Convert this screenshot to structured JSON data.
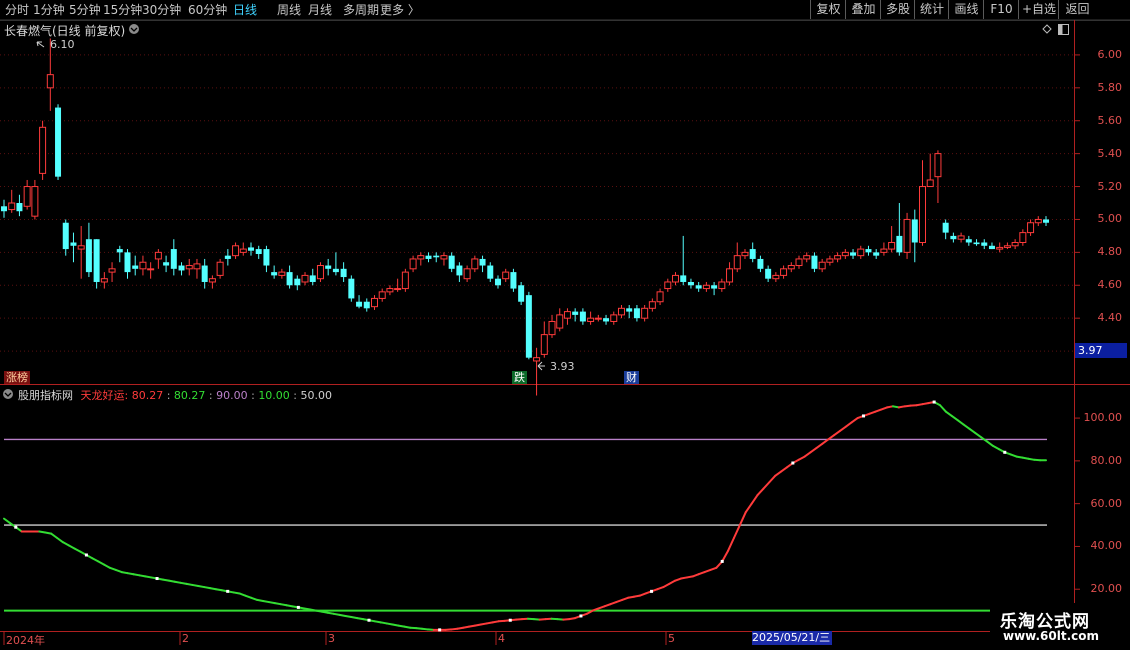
{
  "toolbar": {
    "periods": [
      {
        "label": "分时",
        "active": false
      },
      {
        "label": "1分钟",
        "active": false
      },
      {
        "label": "5分钟",
        "active": false
      },
      {
        "label": "15分钟",
        "active": false
      },
      {
        "label": "30分钟",
        "active": false
      },
      {
        "label": "60分钟",
        "active": false
      },
      {
        "label": "日线",
        "active": true
      },
      {
        "label": "周线",
        "active": false
      },
      {
        "label": "月线",
        "active": false
      },
      {
        "label": "多周期",
        "active": false
      },
      {
        "label": "更多 〉",
        "active": false
      }
    ],
    "buttons": [
      "复权",
      "叠加",
      "多股",
      "统计",
      "画线",
      "F10",
      "+自选",
      "返回"
    ]
  },
  "main_chart": {
    "title": "长春燃气(日线 前复权)",
    "high_label": "6.10",
    "low_label": "3.93",
    "last_price": "3.97",
    "tags": {
      "zhangbang": "涨榜",
      "die": "跌",
      "cai": "财"
    }
  },
  "indicator": {
    "name": "股朋指标网",
    "values": [
      {
        "text": "天龙好运: 80.27",
        "color": "#ff3b3b"
      },
      {
        "text": "80.27",
        "color": "#33dd33"
      },
      {
        "text": "90.00",
        "color": "#b980c8"
      },
      {
        "text": "10.00",
        "color": "#33dd33"
      },
      {
        "text": "50.00",
        "color": "#d0d0d0"
      }
    ]
  },
  "time_axis": {
    "labels": [
      "2024年",
      "2",
      "3",
      "4",
      "5"
    ],
    "selected_date": "2025/05/21/三"
  },
  "watermark": {
    "title": "乐淘公式网",
    "url": "www.60lt.com"
  },
  "chart_data": [
    {
      "type": "candlestick",
      "title": "长春燃气(日线 前复权)",
      "y_axis_ticks": [
        4.2,
        4.4,
        4.6,
        4.8,
        5.0,
        5.2,
        5.4,
        5.6,
        5.8,
        6.0
      ],
      "ylim": [
        4.0,
        6.2
      ],
      "annotations": [
        {
          "text": "6.10",
          "type": "high"
        },
        {
          "text": "3.93",
          "type": "low"
        }
      ],
      "candles": [
        [
          5.08,
          5.05,
          5.12,
          5.01
        ],
        [
          5.06,
          5.1,
          5.18,
          5.04
        ],
        [
          5.1,
          5.05,
          5.15,
          5.02
        ],
        [
          5.08,
          5.2,
          5.24,
          5.06
        ],
        [
          5.02,
          5.2,
          5.24,
          5.0
        ],
        [
          5.28,
          5.56,
          5.6,
          5.24
        ],
        [
          5.8,
          5.88,
          6.1,
          5.66
        ],
        [
          5.68,
          5.26,
          5.7,
          5.24
        ],
        [
          4.98,
          4.82,
          5.0,
          4.78
        ],
        [
          4.86,
          4.84,
          4.92,
          4.74
        ],
        [
          4.82,
          4.84,
          4.96,
          4.64
        ],
        [
          4.88,
          4.68,
          4.98,
          4.65
        ],
        [
          4.88,
          4.62,
          4.88,
          4.58
        ],
        [
          4.62,
          4.64,
          4.68,
          4.58
        ],
        [
          4.68,
          4.7,
          4.74,
          4.62
        ],
        [
          4.82,
          4.8,
          4.84,
          4.74
        ],
        [
          4.8,
          4.68,
          4.82,
          4.64
        ],
        [
          4.72,
          4.7,
          4.78,
          4.66
        ],
        [
          4.7,
          4.74,
          4.78,
          4.66
        ],
        [
          4.7,
          4.7,
          4.74,
          4.64
        ],
        [
          4.76,
          4.8,
          4.82,
          4.7
        ],
        [
          4.74,
          4.72,
          4.78,
          4.68
        ],
        [
          4.82,
          4.7,
          4.88,
          4.66
        ],
        [
          4.72,
          4.69,
          4.74,
          4.66
        ],
        [
          4.7,
          4.72,
          4.76,
          4.66
        ],
        [
          4.7,
          4.73,
          4.76,
          4.64
        ],
        [
          4.72,
          4.62,
          4.76,
          4.58
        ],
        [
          4.62,
          4.64,
          4.66,
          4.58
        ],
        [
          4.66,
          4.74,
          4.76,
          4.64
        ],
        [
          4.78,
          4.76,
          4.82,
          4.72
        ],
        [
          4.78,
          4.84,
          4.86,
          4.76
        ],
        [
          4.8,
          4.82,
          4.86,
          4.78
        ],
        [
          4.83,
          4.81,
          4.86,
          4.78
        ],
        [
          4.82,
          4.79,
          4.84,
          4.76
        ],
        [
          4.82,
          4.72,
          4.84,
          4.68
        ],
        [
          4.68,
          4.66,
          4.72,
          4.64
        ],
        [
          4.66,
          4.68,
          4.7,
          4.64
        ],
        [
          4.68,
          4.6,
          4.72,
          4.58
        ],
        [
          4.64,
          4.6,
          4.66,
          4.57
        ],
        [
          4.62,
          4.66,
          4.68,
          4.6
        ],
        [
          4.66,
          4.62,
          4.7,
          4.6
        ],
        [
          4.64,
          4.72,
          4.74,
          4.62
        ],
        [
          4.72,
          4.7,
          4.76,
          4.66
        ],
        [
          4.7,
          4.68,
          4.8,
          4.66
        ],
        [
          4.7,
          4.65,
          4.74,
          4.62
        ],
        [
          4.64,
          4.52,
          4.66,
          4.5
        ],
        [
          4.5,
          4.47,
          4.54,
          4.46
        ],
        [
          4.5,
          4.46,
          4.52,
          4.44
        ],
        [
          4.47,
          4.52,
          4.54,
          4.45
        ],
        [
          4.52,
          4.56,
          4.58,
          4.5
        ],
        [
          4.56,
          4.58,
          4.6,
          4.54
        ],
        [
          4.58,
          4.58,
          4.64,
          4.56
        ],
        [
          4.58,
          4.68,
          4.7,
          4.56
        ],
        [
          4.7,
          4.76,
          4.78,
          4.68
        ],
        [
          4.76,
          4.78,
          4.8,
          4.72
        ],
        [
          4.78,
          4.76,
          4.8,
          4.74
        ],
        [
          4.78,
          4.77,
          4.8,
          4.74
        ],
        [
          4.76,
          4.78,
          4.8,
          4.72
        ],
        [
          4.78,
          4.7,
          4.8,
          4.68
        ],
        [
          4.72,
          4.66,
          4.74,
          4.62
        ],
        [
          4.64,
          4.7,
          4.72,
          4.62
        ],
        [
          4.7,
          4.76,
          4.78,
          4.68
        ],
        [
          4.76,
          4.72,
          4.78,
          4.68
        ],
        [
          4.72,
          4.64,
          4.74,
          4.62
        ],
        [
          4.64,
          4.6,
          4.66,
          4.58
        ],
        [
          4.64,
          4.68,
          4.7,
          4.62
        ],
        [
          4.68,
          4.58,
          4.7,
          4.56
        ],
        [
          4.6,
          4.5,
          4.62,
          4.48
        ],
        [
          4.54,
          4.16,
          4.56,
          4.15
        ],
        [
          4.14,
          4.16,
          4.22,
          3.93
        ],
        [
          4.18,
          4.3,
          4.38,
          4.16
        ],
        [
          4.3,
          4.38,
          4.42,
          4.28
        ],
        [
          4.34,
          4.42,
          4.46,
          4.32
        ],
        [
          4.4,
          4.44,
          4.46,
          4.36
        ],
        [
          4.44,
          4.42,
          4.46,
          4.38
        ],
        [
          4.44,
          4.38,
          4.46,
          4.36
        ],
        [
          4.38,
          4.4,
          4.44,
          4.36
        ],
        [
          4.4,
          4.4,
          4.42,
          4.38
        ],
        [
          4.4,
          4.38,
          4.42,
          4.36
        ],
        [
          4.38,
          4.42,
          4.44,
          4.36
        ],
        [
          4.42,
          4.46,
          4.48,
          4.4
        ],
        [
          4.46,
          4.44,
          4.48,
          4.4
        ],
        [
          4.46,
          4.4,
          4.48,
          4.38
        ],
        [
          4.4,
          4.46,
          4.48,
          4.38
        ],
        [
          4.46,
          4.5,
          4.52,
          4.44
        ],
        [
          4.5,
          4.56,
          4.58,
          4.48
        ],
        [
          4.58,
          4.62,
          4.64,
          4.56
        ],
        [
          4.62,
          4.66,
          4.68,
          4.6
        ],
        [
          4.66,
          4.62,
          4.9,
          4.6
        ],
        [
          4.62,
          4.6,
          4.64,
          4.58
        ],
        [
          4.6,
          4.58,
          4.62,
          4.56
        ],
        [
          4.58,
          4.6,
          4.62,
          4.56
        ],
        [
          4.6,
          4.58,
          4.62,
          4.54
        ],
        [
          4.58,
          4.62,
          4.64,
          4.56
        ],
        [
          4.62,
          4.7,
          4.74,
          4.6
        ],
        [
          4.7,
          4.78,
          4.86,
          4.68
        ],
        [
          4.78,
          4.8,
          4.82,
          4.76
        ],
        [
          4.82,
          4.76,
          4.86,
          4.74
        ],
        [
          4.76,
          4.7,
          4.78,
          4.68
        ],
        [
          4.7,
          4.64,
          4.72,
          4.62
        ],
        [
          4.64,
          4.66,
          4.68,
          4.62
        ],
        [
          4.66,
          4.7,
          4.72,
          4.64
        ],
        [
          4.7,
          4.72,
          4.74,
          4.68
        ],
        [
          4.72,
          4.76,
          4.78,
          4.7
        ],
        [
          4.76,
          4.78,
          4.8,
          4.74
        ],
        [
          4.78,
          4.7,
          4.8,
          4.68
        ],
        [
          4.7,
          4.74,
          4.76,
          4.68
        ],
        [
          4.74,
          4.76,
          4.78,
          4.72
        ],
        [
          4.76,
          4.78,
          4.8,
          4.74
        ],
        [
          4.78,
          4.8,
          4.82,
          4.76
        ],
        [
          4.8,
          4.78,
          4.82,
          4.76
        ],
        [
          4.78,
          4.82,
          4.84,
          4.76
        ],
        [
          4.82,
          4.8,
          4.84,
          4.78
        ],
        [
          4.8,
          4.78,
          4.82,
          4.76
        ],
        [
          4.8,
          4.82,
          4.86,
          4.78
        ],
        [
          4.82,
          4.86,
          4.96,
          4.8
        ],
        [
          4.9,
          4.8,
          5.1,
          4.78
        ],
        [
          4.8,
          5.0,
          5.04,
          4.76
        ],
        [
          5.0,
          4.86,
          5.06,
          4.74
        ],
        [
          4.86,
          5.2,
          5.36,
          4.84
        ],
        [
          5.2,
          5.24,
          5.4,
          5.2
        ],
        [
          5.26,
          5.4,
          5.42,
          5.1
        ],
        [
          4.98,
          4.92,
          5.0,
          4.88
        ],
        [
          4.9,
          4.88,
          4.92,
          4.86
        ],
        [
          4.88,
          4.9,
          4.92,
          4.86
        ],
        [
          4.88,
          4.86,
          4.9,
          4.84
        ],
        [
          4.86,
          4.85,
          4.88,
          4.84
        ],
        [
          4.86,
          4.84,
          4.88,
          4.82
        ],
        [
          4.84,
          4.82,
          4.86,
          4.82
        ],
        [
          4.82,
          4.83,
          4.86,
          4.8
        ],
        [
          4.83,
          4.84,
          4.86,
          4.82
        ],
        [
          4.84,
          4.86,
          4.88,
          4.82
        ],
        [
          4.86,
          4.92,
          4.94,
          4.84
        ],
        [
          4.92,
          4.98,
          5.0,
          4.9
        ],
        [
          4.98,
          5.0,
          5.02,
          4.96
        ],
        [
          5.0,
          4.98,
          5.02,
          4.96
        ]
      ]
    },
    {
      "type": "line",
      "title": "股朋指标网",
      "y_axis_ticks": [
        20.0,
        40.0,
        60.0,
        80.0,
        100.0
      ],
      "ylim": [
        0,
        115
      ],
      "reference_lines": [
        {
          "value": 90.0,
          "color": "#b980c8"
        },
        {
          "value": 50.0,
          "color": "#d0d0d0"
        },
        {
          "value": 10.0,
          "color": "#33dd33"
        }
      ],
      "series": [
        {
          "name": "天龙好运",
          "rising_color": "#ff3b3b",
          "falling_color": "#33dd33",
          "values": [
            53,
            51,
            49,
            47,
            47,
            47,
            47,
            46.5,
            46,
            44,
            42,
            40.5,
            39,
            37.5,
            36,
            34.5,
            33,
            31.5,
            30,
            29,
            28,
            27.5,
            27,
            26.5,
            26,
            25.5,
            25,
            24.5,
            24,
            23.5,
            23,
            22.5,
            22,
            21.5,
            21,
            20.5,
            20,
            19.5,
            19,
            18.5,
            18,
            17,
            16,
            15,
            14.5,
            14,
            13.5,
            13,
            12.5,
            12,
            11.5,
            11,
            10.5,
            10,
            9.5,
            9,
            8.5,
            8,
            7.5,
            7,
            6.5,
            6,
            5.5,
            5,
            4.5,
            4,
            3.5,
            3,
            2.5,
            2,
            1.8,
            1.5,
            1.2,
            1,
            1,
            1,
            1.2,
            1.5,
            2,
            2.5,
            3,
            3.5,
            4,
            4.5,
            5,
            5.2,
            5.5,
            5.8,
            6,
            6.2,
            6,
            5.8,
            6,
            6.2,
            6,
            5.8,
            6,
            6.5,
            7.5,
            8.5,
            10,
            11,
            12,
            13,
            14,
            15,
            16,
            16.5,
            17,
            18,
            19,
            20,
            21,
            22.5,
            24,
            25,
            25.5,
            26,
            27,
            28,
            29,
            30,
            33,
            38,
            44,
            50,
            56,
            60,
            64,
            67,
            70,
            73,
            75,
            77,
            79,
            80.5,
            82,
            84,
            86,
            88,
            90,
            92,
            94,
            96,
            98,
            100,
            101,
            102,
            103,
            104,
            105,
            105.5,
            105,
            105.5,
            105.8,
            106,
            106.5,
            107,
            107.5,
            106,
            103,
            101,
            99,
            97,
            95,
            93,
            91,
            89,
            87,
            85.5,
            84,
            83,
            82,
            81.5,
            81,
            80.5,
            80.3,
            80.27
          ]
        }
      ]
    }
  ]
}
